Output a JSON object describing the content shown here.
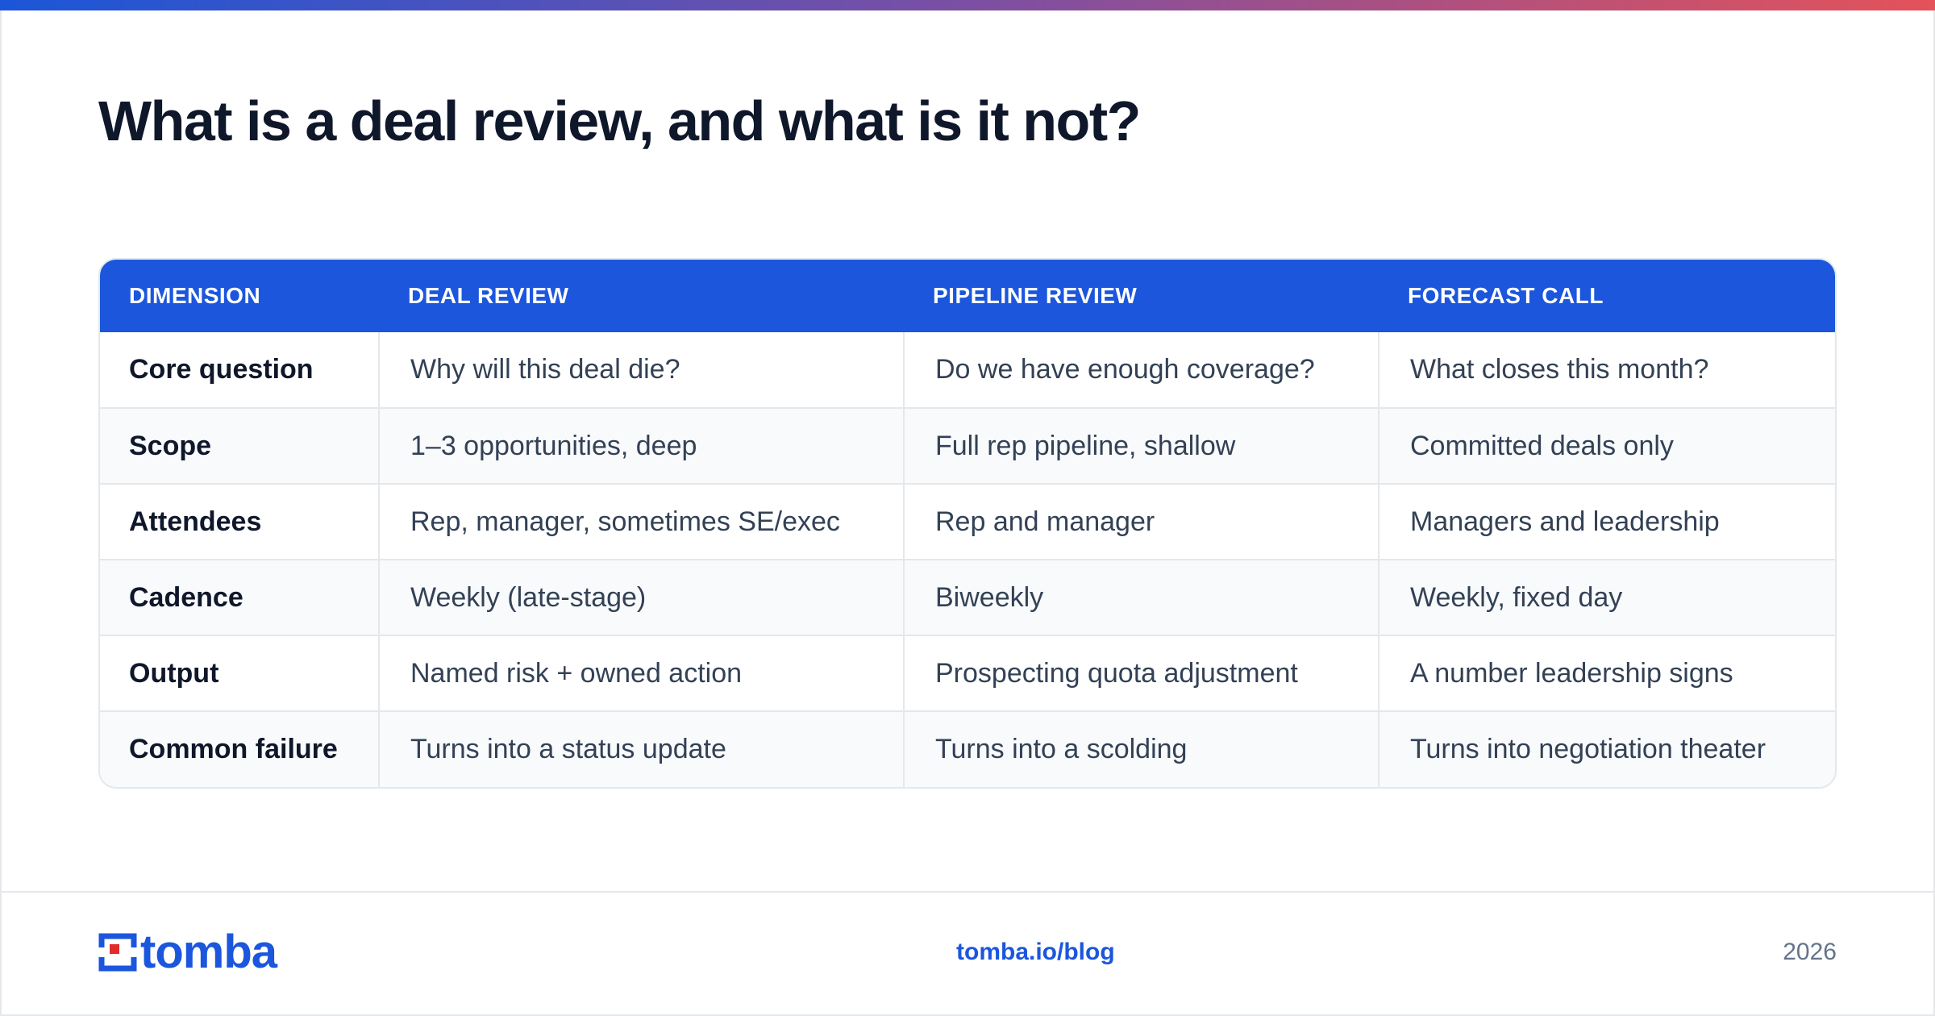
{
  "title": "What is a deal review, and what is it not?",
  "colors": {
    "accent": "#1b56dd",
    "gradient_start": "#1b56d8",
    "gradient_end": "#e4525a",
    "logo_red": "#e32b2b"
  },
  "table": {
    "headers": [
      "DIMENSION",
      "DEAL REVIEW",
      "PIPELINE REVIEW",
      "FORECAST CALL"
    ],
    "rows": [
      [
        "Core question",
        "Why will this deal die?",
        "Do we have enough coverage?",
        "What closes this month?"
      ],
      [
        "Scope",
        "1–3 opportunities, deep",
        "Full rep pipeline, shallow",
        "Committed deals only"
      ],
      [
        "Attendees",
        "Rep, manager, sometimes SE/exec",
        "Rep and manager",
        "Managers and leadership"
      ],
      [
        "Cadence",
        "Weekly (late-stage)",
        "Biweekly",
        "Weekly, fixed day"
      ],
      [
        "Output",
        "Named risk + owned action",
        "Prospecting quota adjustment",
        "A number leadership signs"
      ],
      [
        "Common failure",
        "Turns into a status update",
        "Turns into a scolding",
        "Turns into negotiation theater"
      ]
    ]
  },
  "footer": {
    "logo_text": "tomba",
    "logo_icon": "tomba-logo-icon",
    "link": "tomba.io/blog",
    "year": "2026"
  }
}
